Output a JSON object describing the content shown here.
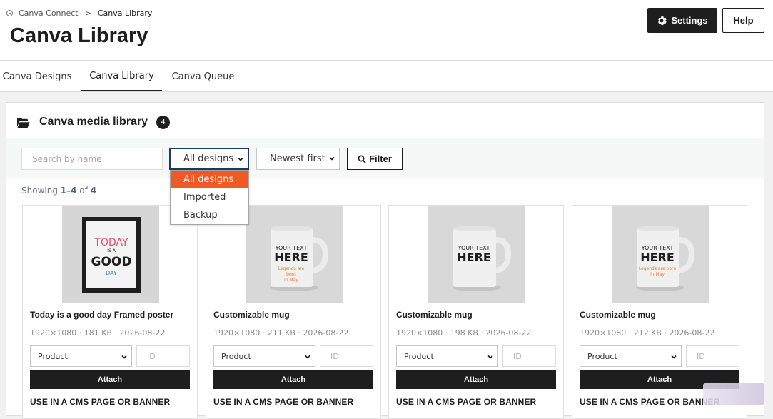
{
  "breadcrumb": {
    "parent": "Canva Connect",
    "separator": ">",
    "current": "Canva Library"
  },
  "page": {
    "title": "Canva Library"
  },
  "header_buttons": {
    "settings": "Settings",
    "help": "Help"
  },
  "tabs": [
    {
      "label": "Canva Designs",
      "active": false
    },
    {
      "label": "Canva Library",
      "active": true
    },
    {
      "label": "Canva Queue",
      "active": false
    }
  ],
  "panel": {
    "title": "Canva media library",
    "count": "4",
    "icon": "folder-open-icon"
  },
  "filters": {
    "search_placeholder": "Search by name",
    "type_selected": "All designs",
    "type_options": [
      "All designs",
      "Imported",
      "Backup"
    ],
    "sort_selected": "Newest first",
    "filter_button": "Filter"
  },
  "showing": {
    "prefix": "Showing",
    "range": "1–4",
    "of": "of",
    "total": "4"
  },
  "cards": [
    {
      "title": "Today is a good day Framed poster",
      "meta": "1920×1080 · 181 KB · 2026-08-22",
      "select": "Product",
      "id_placeholder": "ID",
      "attach": "Attach",
      "cms": "USE IN A CMS PAGE OR BANNER",
      "thumb": {
        "kind": "poster",
        "lines": [
          "TODAY",
          "IS A",
          "GOOD",
          "DAY"
        ]
      }
    },
    {
      "title": "Customizable mug",
      "meta": "1920×1080 · 211 KB · 2026-08-22",
      "select": "Product",
      "id_placeholder": "ID",
      "attach": "Attach",
      "cms": "USE IN A CMS PAGE OR BANNER",
      "thumb": {
        "kind": "mug",
        "lines": [
          "YOUR TEXT",
          "HERE"
        ],
        "sub": [
          "Legends are",
          "born",
          "in May"
        ]
      }
    },
    {
      "title": "Customizable mug",
      "meta": "1920×1080 · 198 KB · 2026-08-22",
      "select": "Product",
      "id_placeholder": "ID",
      "attach": "Attach",
      "cms": "USE IN A CMS PAGE OR BANNER",
      "thumb": {
        "kind": "mug",
        "lines": [
          "YOUR TEXT",
          "HERE"
        ],
        "sub": []
      }
    },
    {
      "title": "Customizable mug",
      "meta": "1920×1080 · 212 KB · 2026-08-22",
      "select": "Product",
      "id_placeholder": "ID",
      "attach": "Attach",
      "cms": "USE IN A CMS PAGE OR BANNER",
      "thumb": {
        "kind": "mug",
        "lines": [
          "YOUR TEXT",
          "HERE"
        ],
        "sub": [
          "Legends are born",
          "in May"
        ]
      }
    }
  ],
  "colors": {
    "accent": "#ef5a24",
    "dark": "#1e1e1e",
    "muted": "#8a8a8a",
    "showing_count": "#4b5f7a"
  }
}
